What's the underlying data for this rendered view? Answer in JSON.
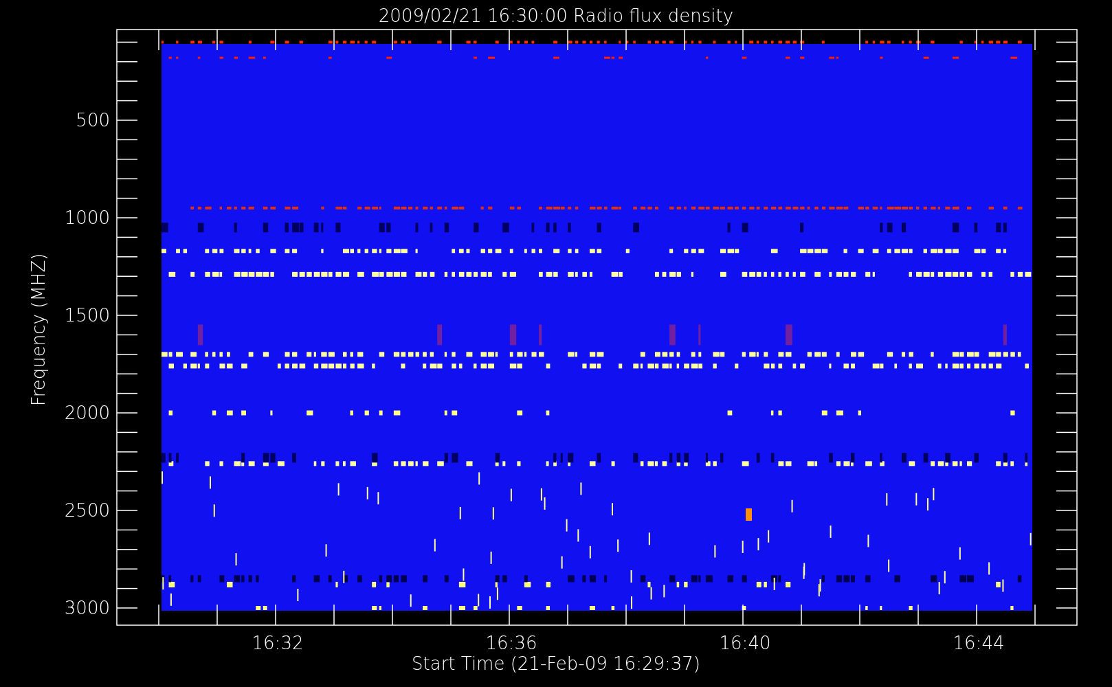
{
  "title": "2009/02/21 16:30:00 Radio flux density",
  "ylabel": "Frequency (MHZ)",
  "xlabel": "Start Time (21-Feb-09 16:29:37)",
  "yticks": [
    "500",
    "1000",
    "1500",
    "2000",
    "2500",
    "3000"
  ],
  "xticks": [
    "16:32",
    "16:36",
    "16:40",
    "16:44"
  ]
}
